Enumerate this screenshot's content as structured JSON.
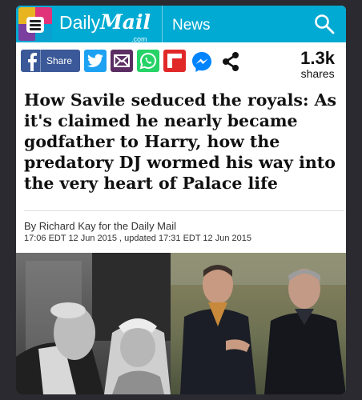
{
  "header": {
    "logo_daily": "Daily",
    "logo_mail": "Mail",
    "logo_domain": ".com",
    "section": "News",
    "colors": {
      "bar": "#00aad2"
    }
  },
  "share": {
    "share_label": "Share",
    "count": "1.3k",
    "count_label": "shares",
    "icons": [
      "facebook-icon",
      "twitter-icon",
      "email-icon",
      "whatsapp-icon",
      "flipboard-icon",
      "messenger-icon",
      "share-icon"
    ],
    "colors": {
      "facebook": "#3b5998",
      "twitter": "#1da1f2",
      "email": "#5b2d63",
      "whatsapp": "#25d366",
      "flipboard": "#e12828",
      "messenger": "#0084ff"
    }
  },
  "article": {
    "headline": "How Savile seduced the royals: As it's claimed he nearly became godfather to Harry, how the predatory DJ wormed his way into the very heart of Palace life",
    "byline": "By Richard Kay for the Daily Mail",
    "timestamp": "17:06 EDT 12 Jun 2015 , updated 17:31 EDT 12 Jun 2015"
  }
}
